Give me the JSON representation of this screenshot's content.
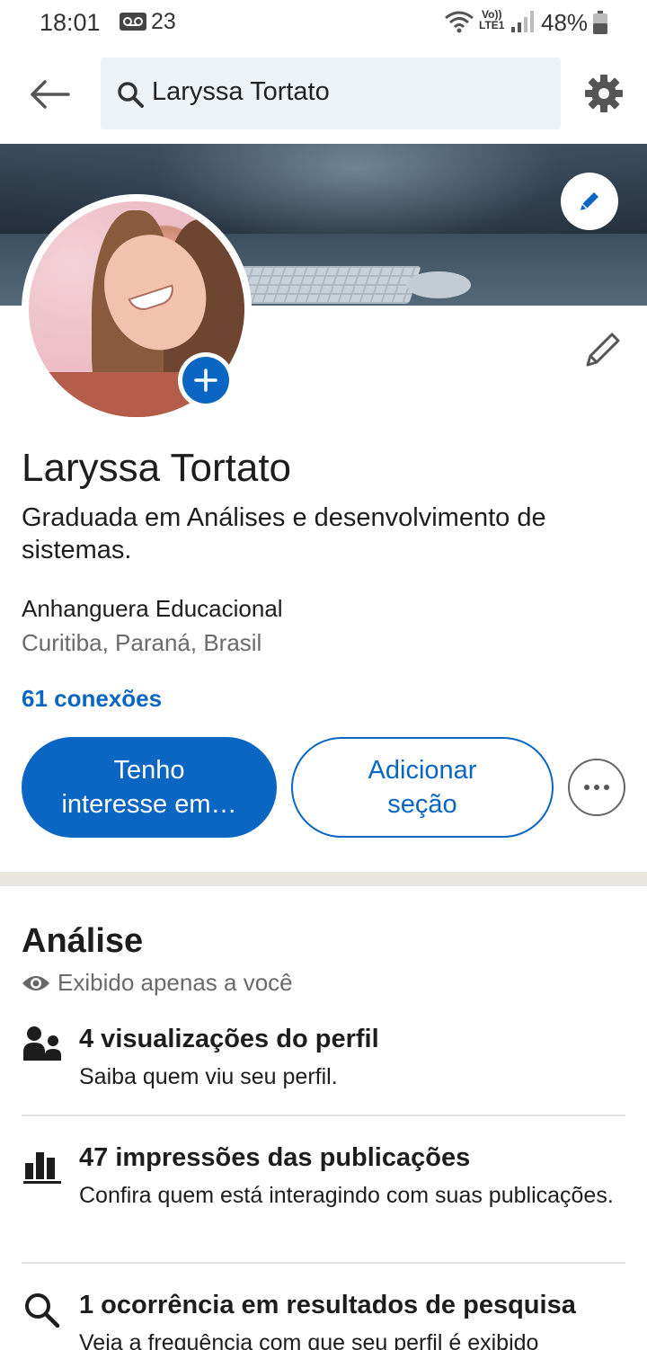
{
  "status_bar": {
    "time": "18:01",
    "temperature": "23",
    "volte_line1": "Vo))",
    "volte_line2": "LTE1",
    "battery": "48%"
  },
  "header": {
    "search_value": "Laryssa Tortato",
    "icons": [
      "arrow-left-icon",
      "search-icon",
      "gear-icon"
    ]
  },
  "profile": {
    "name": "Laryssa Tortato",
    "headline": "Graduada em Análises e desenvolvimento de sistemas.",
    "company": "Anhanguera Educacional",
    "location": "Curitiba, Paraná, Brasil",
    "connections": "61 conexões"
  },
  "actions": {
    "primary_label": "Tenho interesse em…",
    "secondary_label": "Adicionar seção",
    "more_icon": "more-horizontal-icon"
  },
  "analytics": {
    "title": "Análise",
    "visibility": "Exibido apenas a você",
    "items": [
      {
        "icon": "people-icon",
        "heading": "4 visualizações do perfil",
        "description": "Saiba quem viu seu perfil."
      },
      {
        "icon": "bar-chart-icon",
        "heading": "47 impressões das publicações",
        "description": "Confira quem está interagindo com suas publicações."
      },
      {
        "icon": "search-icon",
        "heading": "1 ocorrência em resultados de pesquisa",
        "description": "Veja a frequência com que seu perfil é exibido"
      }
    ]
  },
  "colors": {
    "accent": "#0a66c2",
    "search_bg": "#eef3f8",
    "divider": "#e9e5df"
  }
}
